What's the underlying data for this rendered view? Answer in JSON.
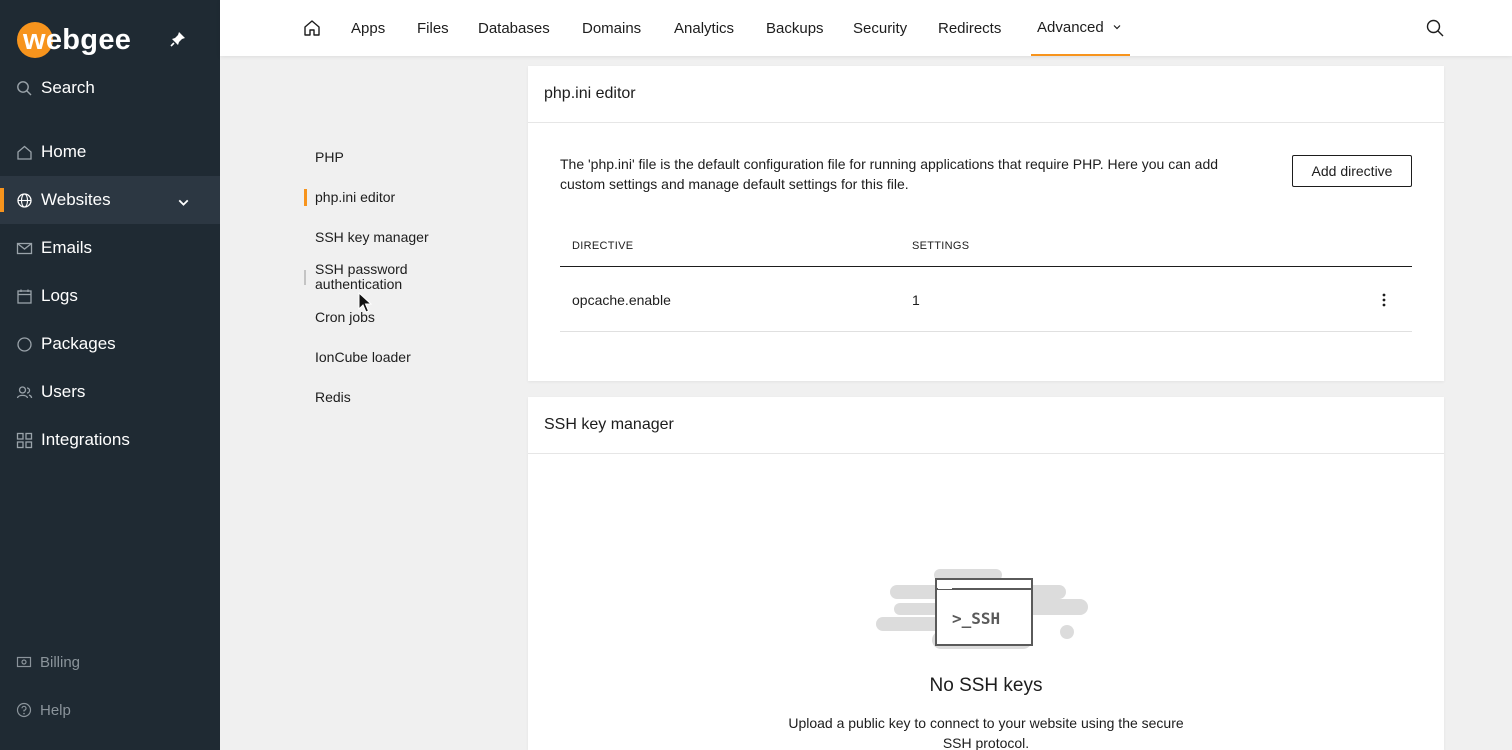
{
  "brand": {
    "logo_text": "webgee",
    "accent": "#f7941d",
    "sidebar_bg": "#1f2a33"
  },
  "sidebar": {
    "search_label": "Search",
    "items": [
      {
        "label": "Home",
        "icon": "home-icon"
      },
      {
        "label": "Websites",
        "icon": "globe-icon",
        "active": true,
        "expandable": true
      },
      {
        "label": "Emails",
        "icon": "mail-icon"
      },
      {
        "label": "Logs",
        "icon": "calendar-icon"
      },
      {
        "label": "Packages",
        "icon": "circle-icon"
      },
      {
        "label": "Users",
        "icon": "users-icon"
      },
      {
        "label": "Integrations",
        "icon": "grid-icon"
      }
    ],
    "bottom": [
      {
        "label": "Billing",
        "icon": "billing-icon"
      },
      {
        "label": "Help",
        "icon": "help-icon"
      }
    ]
  },
  "topnav": {
    "tabs": [
      "Apps",
      "Files",
      "Databases",
      "Domains",
      "Analytics",
      "Backups",
      "Security",
      "Redirects",
      "Advanced"
    ],
    "active_tab": "Advanced"
  },
  "subnav": {
    "items": [
      "PHP",
      "php.ini editor",
      "SSH key manager",
      "SSH password\nauthentication",
      "Cron jobs",
      "IonCube loader",
      "Redis"
    ],
    "active": "php.ini editor"
  },
  "php_ini": {
    "title": "php.ini editor",
    "description": "The 'php.ini' file is the default configuration file for running applications that require PHP. Here you can add custom settings and manage default settings for this file.",
    "add_button": "Add directive",
    "columns": [
      "DIRECTIVE",
      "SETTINGS"
    ],
    "rows": [
      {
        "directive": "opcache.enable",
        "setting": "1"
      }
    ]
  },
  "ssh_keys": {
    "title": "SSH key manager",
    "illustration_text": ">_SSH",
    "empty_title": "No SSH keys",
    "empty_description": "Upload a public key to connect to your website using the secure SSH protocol."
  }
}
